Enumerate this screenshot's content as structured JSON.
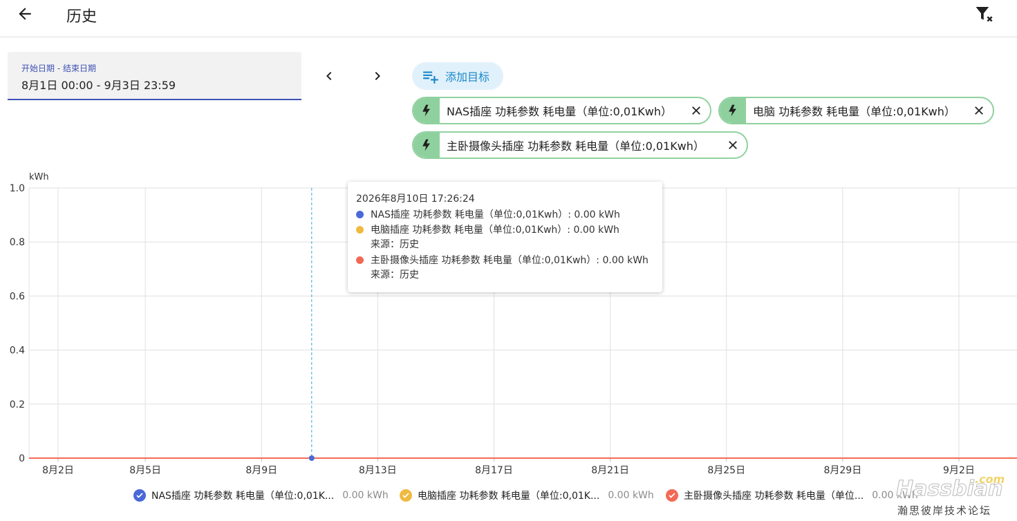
{
  "header": {
    "title": "历史",
    "back_icon": "arrow-left-icon",
    "filter_icon": "filter-remove-icon"
  },
  "date_picker": {
    "label": "开始日期 - 结束日期",
    "value": "8月1日 00:00 - 9月3日 23:59"
  },
  "nav": {
    "prev_icon": "chevron-left-icon",
    "next_icon": "chevron-right-icon"
  },
  "add_target": {
    "label": "添加目标",
    "icon": "playlist-plus-icon"
  },
  "targets": [
    {
      "label": "NAS插座 功耗参数 耗电量（单位:0,01Kwh）",
      "icon": "lightning-bolt-icon"
    },
    {
      "label": "电脑 功耗参数 耗电量（单位:0,01Kwh）",
      "icon": "lightning-bolt-icon"
    },
    {
      "label": "主卧摄像头插座 功耗参数 耗电量（单位:0,01Kwh）",
      "icon": "lightning-bolt-icon"
    }
  ],
  "colors": {
    "accent": "#3f51b5",
    "chip_green": "#8fd19e",
    "series_blue": "#4a69d8",
    "series_yellow": "#f0b940",
    "series_red": "#f26a55",
    "cursor": "#29a8e0"
  },
  "tooltip": {
    "timestamp": "2026年8月10日 17:26:24",
    "rows": [
      {
        "text": "NAS插座 功耗参数 耗电量（单位:0,01Kwh）: 0.00 kWh"
      },
      {
        "text": "电脑插座 功耗参数 耗电量（单位:0,01Kwh）: 0.00 kWh",
        "sub": "来源：历史"
      },
      {
        "text": "主卧摄像头插座 功耗参数 耗电量（单位:0,01Kwh）: 0.00 kWh",
        "sub": "来源：历史"
      }
    ]
  },
  "legend": [
    {
      "name": "NAS插座 功耗参数 耗电量（单位:0,01K...",
      "value": "0.00 kWh"
    },
    {
      "name": "电脑插座 功耗参数 耗电量（单位:0,01K...",
      "value": "0.00 kWh"
    },
    {
      "name": "主卧摄像头插座 功耗参数 耗电量（单位...",
      "value": "0.00 kWh"
    }
  ],
  "watermark": {
    "main": "Hassbian",
    "com": ".com",
    "sub": "瀚思彼岸技术论坛"
  },
  "chart_data": {
    "type": "line",
    "ylabel": "kWh",
    "ylim": [
      0,
      1.0
    ],
    "y_ticks": [
      "1.0",
      "0.8",
      "0.6",
      "0.4",
      "0.2",
      "0"
    ],
    "x_ticks": [
      "8月2日",
      "8月5日",
      "8月9日",
      "8月13日",
      "8月17日",
      "8月21日",
      "8月25日",
      "8月29日",
      "9月2日"
    ],
    "x_range": [
      "2026-08-01 00:00",
      "2026-09-03 23:59"
    ],
    "cursor_x": "2026-08-10 17:26:24",
    "grid": true,
    "legend_position": "bottom",
    "series": [
      {
        "name": "NAS插座 功耗参数 耗电量（单位:0,01Kwh）",
        "x": [
          "2026-08-01 00:00",
          "2026-09-03 23:59"
        ],
        "y": [
          0,
          0
        ]
      },
      {
        "name": "电脑插座 功耗参数 耗电量（单位:0,01Kwh）",
        "x": [
          "2026-08-01 00:00",
          "2026-09-03 23:59"
        ],
        "y": [
          0,
          0
        ]
      },
      {
        "name": "主卧摄像头插座 功耗参数 耗电量（单位:0,01Kwh）",
        "x": [
          "2026-08-01 00:00",
          "2026-09-03 23:59"
        ],
        "y": [
          0,
          0
        ]
      }
    ]
  }
}
